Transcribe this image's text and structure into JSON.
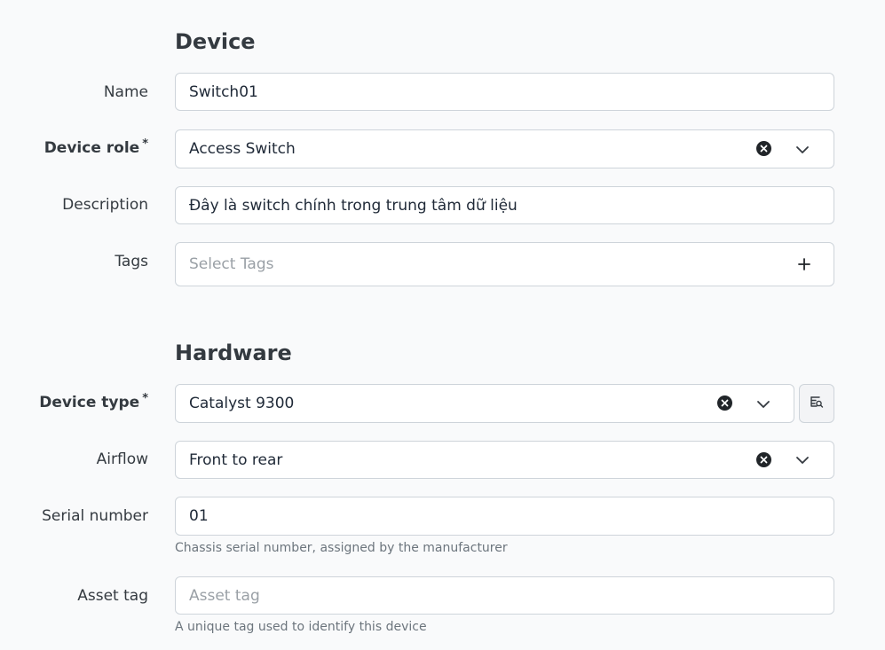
{
  "sections": {
    "device": {
      "title": "Device"
    },
    "hardware": {
      "title": "Hardware"
    }
  },
  "fields": {
    "name": {
      "label": "Name",
      "value": "Switch01"
    },
    "device_role": {
      "label": "Device role",
      "required_mark": "*",
      "value": "Access Switch"
    },
    "description": {
      "label": "Description",
      "value": "Đây là switch chính trong trung tâm dữ liệu"
    },
    "tags": {
      "label": "Tags",
      "placeholder": "Select Tags"
    },
    "device_type": {
      "label": "Device type",
      "required_mark": "*",
      "value": "Catalyst 9300"
    },
    "airflow": {
      "label": "Airflow",
      "value": "Front to rear"
    },
    "serial_number": {
      "label": "Serial number",
      "value": "01",
      "help": "Chassis serial number, assigned by the manufacturer"
    },
    "asset_tag": {
      "label": "Asset tag",
      "placeholder": "Asset tag",
      "help": "A unique tag used to identify this device"
    }
  },
  "icons": {
    "clear": "clear-icon",
    "chevron": "chevron-down-icon",
    "plus": "plus-icon",
    "lookup": "search-lookup-icon"
  },
  "colors": {
    "background": "#f9fafb",
    "field_border": "#ced4da",
    "text": "#1f2937",
    "help_text": "#6c757d",
    "placeholder": "#9aa0a6"
  }
}
